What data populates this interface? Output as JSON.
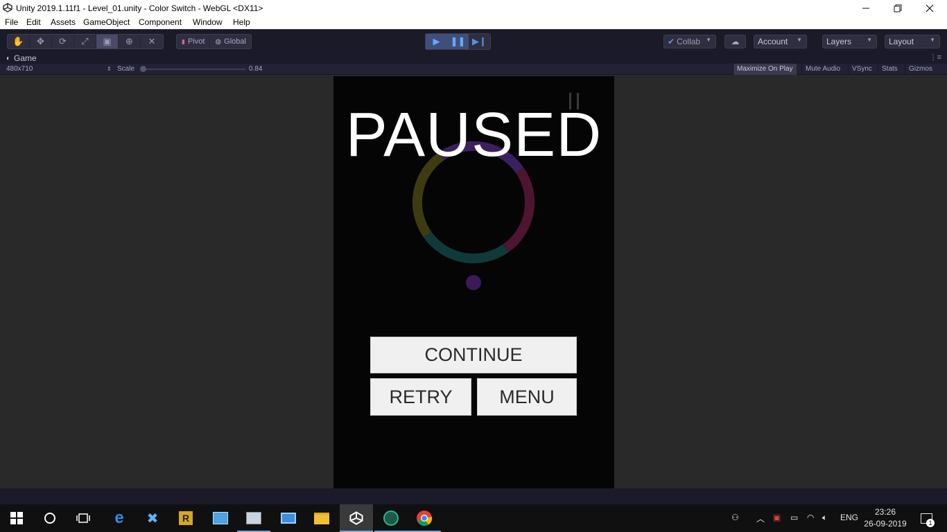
{
  "window": {
    "title": "Unity 2019.1.11f1 - Level_01.unity - Color Switch - WebGL <DX11>",
    "minimize_icon": "minimize-icon",
    "maximize_icon": "restore-icon",
    "close_icon": "close-icon"
  },
  "menu": [
    "File",
    "Edit",
    "Assets",
    "GameObject",
    "Component",
    "Window",
    "Help"
  ],
  "toolbar": {
    "tools": [
      "hand-icon",
      "move-icon",
      "rotate-icon",
      "scale-icon",
      "rect-icon",
      "transform-icon",
      "custom-tool-icon"
    ],
    "pivot_label": "Pivot",
    "global_label": "Global",
    "collab_label": "Collab",
    "account_label": "Account",
    "layers_label": "Layers",
    "layout_label": "Layout"
  },
  "game_tab": {
    "label": "Game",
    "resolution": "480x710",
    "scale_label": "Scale",
    "scale_value": "0.84",
    "options": [
      "Maximize On Play",
      "Mute Audio",
      "VSync",
      "Stats",
      "Gizmos"
    ]
  },
  "game": {
    "paused_text": "PAUSED",
    "continue_label": "CONTINUE",
    "retry_label": "RETRY",
    "menu_label": "MENU",
    "ring_colors": [
      "#3b1f5e",
      "#4d1530",
      "#103a3a",
      "#3e3a12"
    ],
    "dot_color": "#3c1a58"
  },
  "tray": {
    "language": "ENG",
    "time": "23:26",
    "date": "26-09-2019",
    "notification_count": "1"
  }
}
